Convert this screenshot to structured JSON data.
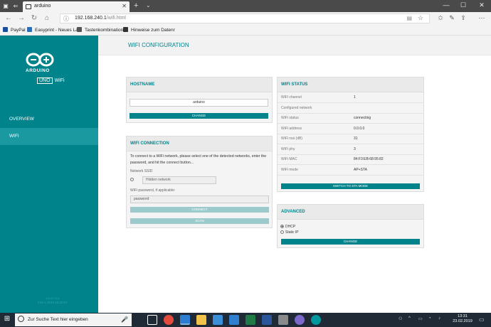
{
  "browser": {
    "tab_title": "arduino",
    "url_host": "192.168.240.1",
    "url_path": "/wifi.html",
    "favorites": [
      {
        "label": "PayPal",
        "color": "#1a4d9c"
      },
      {
        "label": "Easyprint - Neues Lal",
        "color": "#2c6fb8"
      },
      {
        "label": "Tastenkombination f",
        "color": "#555555"
      },
      {
        "label": "Hinweise zum Datenr",
        "color": "#333333"
      }
    ]
  },
  "sidebar": {
    "brand": "ARDUINO",
    "uno_badge": "UNO",
    "uno_suffix": "WiFi",
    "nav": [
      {
        "label": "OVERVIEW",
        "active": false
      },
      {
        "label": "WIFI",
        "active": true
      }
    ],
    "footer_line1": "v.o.n.i.n.s",
    "footer_line2": "Feb 1 2019 10:30:57"
  },
  "page": {
    "title": "WIFI CONFIGURATION"
  },
  "hostname_panel": {
    "title": "HOSTNAME",
    "value": "arduino",
    "button": "CHANGE"
  },
  "wifi_connection_panel": {
    "title": "WIFI CONNECTION",
    "intro": "To connect to a WiFi network, please select one of the detected networks, enter the password, and hit the connect button...",
    "ssid_label": "Network SSID",
    "hidden_network_placeholder": "Hidden network",
    "password_label": "WiFi password, if applicable:",
    "password_placeholder": "password",
    "connect_button": "CONNECT",
    "scan_button": "SCAN"
  },
  "wifi_status_panel": {
    "title": "WIFI STATUS",
    "rows": [
      {
        "key": "WiFi channel",
        "value": "1"
      },
      {
        "key": "Configured network",
        "value": ""
      },
      {
        "key": "WiFi status",
        "value": "connecting"
      },
      {
        "key": "WiFi address",
        "value": "0.0.0.0"
      },
      {
        "key": "WiFi rssi (dB)",
        "value": "31"
      },
      {
        "key": "WiFi phy",
        "value": "3"
      },
      {
        "key": "WiFi MAC",
        "value": "84:F3:EB:68:95:82"
      },
      {
        "key": "WiFi mode",
        "value": "AP+STA"
      }
    ],
    "button": "SWITCH TO STA MODE"
  },
  "advanced_panel": {
    "title": "ADVANCED",
    "options": [
      {
        "label": "DHCP",
        "checked": true
      },
      {
        "label": "Static IP",
        "checked": false
      }
    ],
    "button": "CHANGE"
  },
  "taskbar": {
    "search_placeholder": "Zur Suche Text hier eingeben",
    "time": "13:31",
    "date": "23.02.2019",
    "apps": [
      {
        "name": "task-view",
        "color": "#ffffff"
      },
      {
        "name": "chrome",
        "color": "#e34c3c"
      },
      {
        "name": "edge",
        "color": "#2d7dd2"
      },
      {
        "name": "explorer",
        "color": "#f2c24b"
      },
      {
        "name": "store",
        "color": "#3b8ed8"
      },
      {
        "name": "app-blue",
        "color": "#2f7fd0"
      },
      {
        "name": "excel",
        "color": "#1f7a45"
      },
      {
        "name": "word",
        "color": "#2b579a"
      },
      {
        "name": "app-gray",
        "color": "#8a8a8a"
      },
      {
        "name": "app-purple",
        "color": "#7b68c8"
      },
      {
        "name": "arduino",
        "color": "#00979d"
      }
    ]
  },
  "colors": {
    "teal": "#00838a",
    "teal_active": "#1a9aa0",
    "disabled_button": "#9cc9cb"
  }
}
